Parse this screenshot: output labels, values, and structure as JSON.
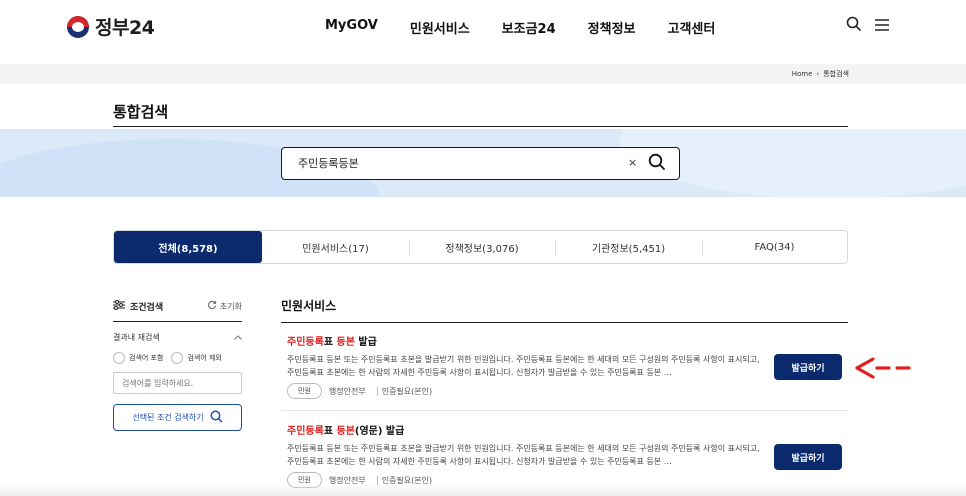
{
  "header": {
    "logo_text": "정부24",
    "nav": [
      "MyGOV",
      "민원서비스",
      "보조금24",
      "정책정보",
      "고객센터"
    ]
  },
  "breadcrumb": {
    "home": "Home",
    "current": "통합검색"
  },
  "page_title": "통합검색",
  "search": {
    "value": "주민등록등본",
    "clear": "×"
  },
  "tabs": [
    "전체(8,578)",
    "민원서비스(17)",
    "정책정보(3,076)",
    "기관정보(5,451)",
    "FAQ(34)"
  ],
  "filter": {
    "title": "조건검색",
    "reset": "초기화",
    "refine_label": "결과내 재검색",
    "radio_include": "검색어 포함",
    "radio_exclude": "검색어 제외",
    "input_placeholder": "검색어를 입력하세요.",
    "apply": "선택된 조건 검색하기"
  },
  "section_title": "민원서비스",
  "results": [
    {
      "title_hl1": "주민등록",
      "title_mid": "표 ",
      "title_hl2": "등본",
      "title_tail": " 발급",
      "desc": "주민등록표 등본 또는 주민등록표 초본을 발급받기 위한 민원입니다. 주민등록표 등본에는 한 세대의 모든 구성원의 주민등록 사항이 표시되고, 주민등록표 초본에는 한 사람의 자세한 주민등록 사항이 표시됩니다. 신청자가 발급받을 수 있는 주민등록표 등본 …",
      "badge": "민원",
      "org": "행정안전부",
      "auth": "인증필요(본인)",
      "button": "발급하기"
    },
    {
      "title_hl1": "주민등록",
      "title_mid": "표 ",
      "title_hl2": "등본",
      "title_tail": "(영문) 발급",
      "desc": "주민등록표 등본 또는 주민등록표 초본을 발급받기 위한 민원입니다. 주민등록표 등본에는 한 세대의 모든 구성원의 주민등록 사항이 표시되고, 주민등록표 초본에는 한 사람의 자세한 주민등록 사항이 표시됩니다. 신청자가 발급받을 수 있는 주민등록표 등본 …",
      "badge": "민원",
      "org": "행정안전부",
      "auth": "인증필요(본인)",
      "button": "발급하기"
    }
  ],
  "colors": {
    "primary_navy": "#0b2a6d",
    "highlight_red": "#e02020",
    "banner_blue": "#dbe9f9"
  }
}
